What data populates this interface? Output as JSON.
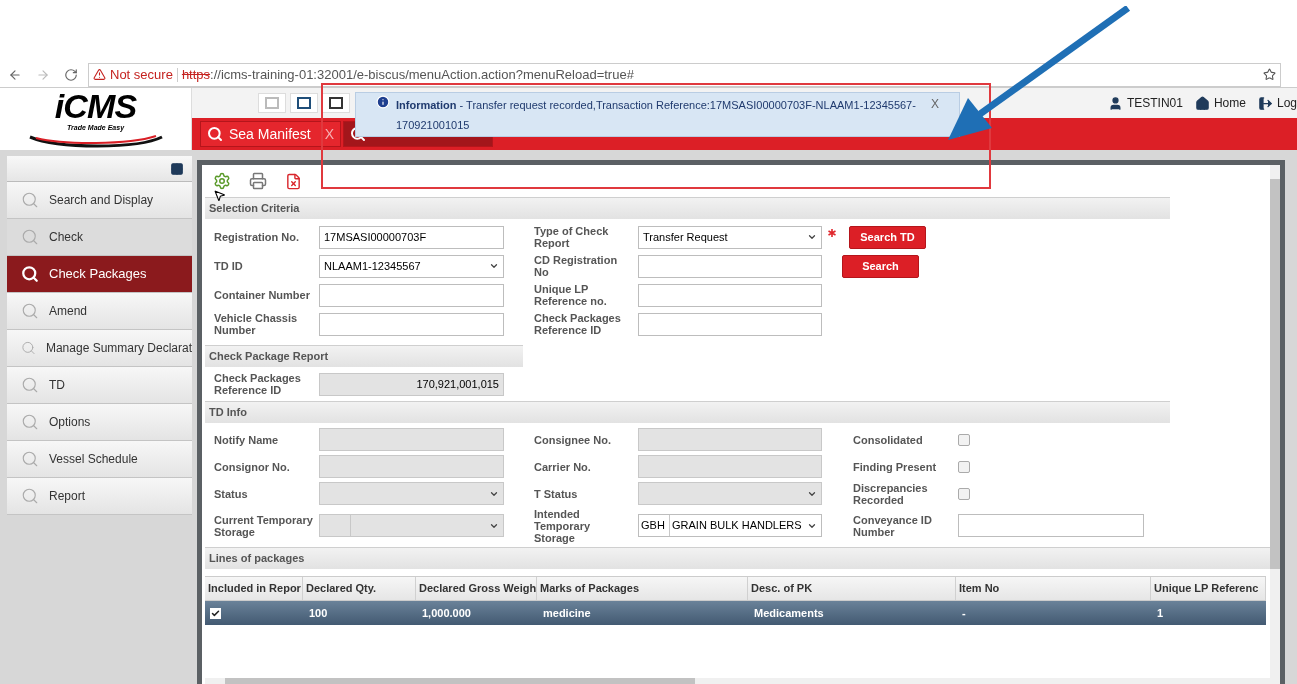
{
  "browser": {
    "security": "Not secure",
    "url_scheme": "https",
    "url_rest": "://icms-training-01:32001/e-biscus/menuAction.action?menuReload=true#"
  },
  "logo": {
    "name": "iCMS",
    "tagline": "Trade Made Easy"
  },
  "user_menu": [
    {
      "kind": "user",
      "label": "TESTIN01"
    },
    {
      "kind": "home",
      "label": "Home"
    },
    {
      "kind": "logout",
      "label": "Log"
    }
  ],
  "notification": {
    "title": "Information",
    "message": " - Transfer request recorded,Transaction Reference:17MSASI00000703F-NLAAM1-12345567-170921001015",
    "close": "X"
  },
  "tabs": [
    {
      "label": "Sea Manifest",
      "close": "X",
      "selected": false
    },
    {
      "selected": true
    }
  ],
  "sidebar": {
    "items": [
      {
        "label": "Search and Display",
        "selected": false
      },
      {
        "label": "Check",
        "selected": false,
        "hovered": true
      },
      {
        "label": "Check Packages",
        "selected": true
      },
      {
        "label": "Amend",
        "selected": false
      },
      {
        "label": "Manage Summary Declarat",
        "selected": false
      },
      {
        "label": "TD",
        "selected": false
      },
      {
        "label": "Options",
        "selected": false
      },
      {
        "label": "Vessel Schedule",
        "selected": false
      },
      {
        "label": "Report",
        "selected": false
      }
    ]
  },
  "selection_criteria": {
    "title": "Selection Criteria",
    "rows": [
      {
        "fields": [
          {
            "label": "Registration No.",
            "kind": "input",
            "value": "17MSASI00000703F",
            "disabled": false
          },
          {
            "label": "Type of Check Report",
            "kind": "select",
            "value": "Transfer Request",
            "disabled": false,
            "required": true
          }
        ],
        "button": "Search TD"
      },
      {
        "fields": [
          {
            "label": "TD ID",
            "kind": "select",
            "value": "NLAAM1-12345567",
            "disabled": false
          },
          {
            "label": "CD Registration No",
            "kind": "input",
            "disabled": false
          }
        ],
        "button": "Search"
      },
      {
        "fields": [
          {
            "label": "Container Number",
            "kind": "input",
            "disabled": false
          },
          {
            "label": "Unique LP Reference no.",
            "kind": "input",
            "disabled": false
          }
        ]
      },
      {
        "fields": [
          {
            "label": "Vehicle Chassis Number",
            "kind": "input",
            "disabled": false
          },
          {
            "label": "Check Packages Reference ID",
            "kind": "input",
            "disabled": false
          }
        ]
      }
    ]
  },
  "check_package_report": {
    "title": "Check Package Report",
    "fields": [
      {
        "label": "Check Packages Reference ID",
        "kind": "input",
        "value": "170,921,001,015",
        "disabled": true
      }
    ]
  },
  "td_info": {
    "title": "TD Info",
    "rows": [
      {
        "fields": [
          {
            "label": "Notify Name",
            "kind": "input",
            "disabled": true
          },
          {
            "label": "Consignee No.",
            "kind": "input",
            "disabled": true
          },
          {
            "label": "Consolidated",
            "kind": "checkbox",
            "checked": false
          }
        ]
      },
      {
        "fields": [
          {
            "label": "Consignor No.",
            "kind": "input",
            "disabled": true
          },
          {
            "label": "Carrier No.",
            "kind": "input",
            "disabled": true
          },
          {
            "label": "Finding Present",
            "kind": "checkbox",
            "checked": false
          }
        ]
      },
      {
        "fields": [
          {
            "label": "Status",
            "kind": "select",
            "disabled": true
          },
          {
            "label": "T Status",
            "kind": "select",
            "disabled": true
          },
          {
            "label": "Discrepancies Recorded",
            "kind": "checkbox",
            "checked": false
          }
        ]
      },
      {
        "fields": [
          {
            "label": "Current Temporary Storage",
            "kind": "split_select",
            "disabled": true
          },
          {
            "label": "Intended Temporary Storage",
            "kind": "split_select",
            "code": "GBH",
            "value": "GRAIN BULK HANDLERS",
            "disabled": false
          },
          {
            "label": "Conveyance ID Number",
            "kind": "input",
            "disabled": false
          }
        ]
      }
    ]
  },
  "lines_of_packages": {
    "title": "Lines of packages",
    "table": {
      "columns": [
        "Included in Repor",
        "Declared Qty.",
        "Declared Gross Weigh",
        "Marks of Packages",
        "Desc. of PK",
        "Item No",
        "Unique LP Referenc"
      ],
      "rows": [
        {
          "selected": true,
          "included": true,
          "cells": [
            "",
            "100",
            "1,000.000",
            "medicine",
            "Medicaments",
            "-",
            "1"
          ]
        }
      ]
    }
  }
}
